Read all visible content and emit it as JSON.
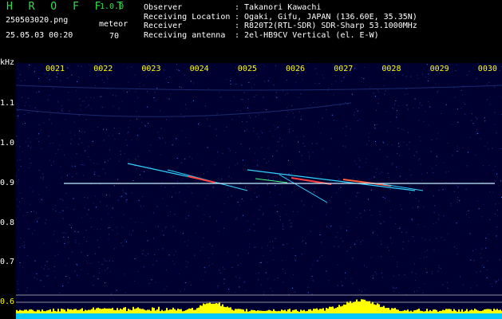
{
  "header": {
    "app_title": "H R O F F T",
    "app_version": "1.0.0",
    "filename": "250503020.png",
    "datetime": "25.05.03 00:20",
    "meteor_label": "meteor",
    "meteor_count": "70",
    "info": [
      {
        "key": "Observer",
        "value": ": Takanori Kawachi"
      },
      {
        "key": "Receiving Location",
        "value": ": Ogaki, Gifu, JAPAN (136.60E, 35.35N)"
      },
      {
        "key": "Receiver",
        "value": ": R820T2(RTL-SDR) SDR-Sharp 53.1000MHz"
      },
      {
        "key": "Receiving antenna",
        "value": ": 2el-HB9CV Vertical (el. E-W)"
      }
    ]
  },
  "spectrogram": {
    "unit_label": "kHz",
    "y_ticks": [
      "1.1",
      "1.0",
      "0.9",
      "0.8",
      "0.7",
      "0.6"
    ],
    "time_labels": [
      "0021",
      "0022",
      "0023",
      "0024",
      "0025",
      "0026",
      "0027",
      "0028",
      "0029",
      "0030"
    ],
    "carrier_khz": 0.9,
    "colors": {
      "background": "#000030",
      "axis_labels": "#ffff00",
      "carrier": "#c8f0ff",
      "level_bar": "#ffff00",
      "level_base": "#00c8ff"
    }
  }
}
